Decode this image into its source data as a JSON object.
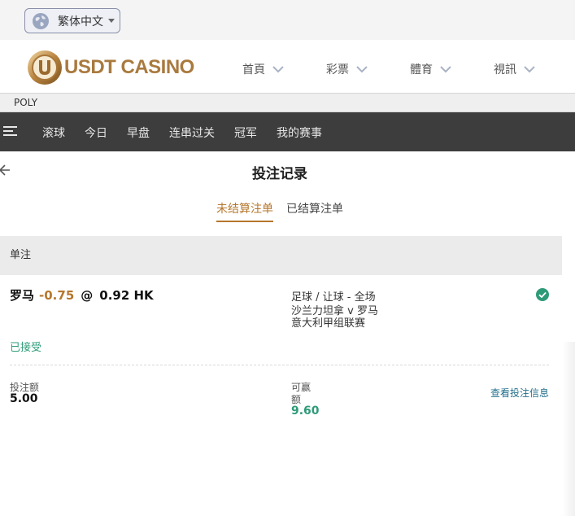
{
  "language": {
    "label": "繁体中文"
  },
  "brand": {
    "name": "USDT CASINO",
    "accent": "#a97a3f"
  },
  "header_nav": [
    "首頁",
    "彩票",
    "體育",
    "視訊"
  ],
  "provider": {
    "label": "POLY"
  },
  "sports_nav": {
    "items": [
      "滚球",
      "今日",
      "早盘",
      "连串过关",
      "冠军",
      "我的赛事"
    ]
  },
  "page": {
    "title": "投注记录"
  },
  "tabs": {
    "active": "未结算注单",
    "inactive": "已结算注单"
  },
  "section": {
    "label": "单注"
  },
  "bet": {
    "selection": "罗马",
    "handicap": "-0.75",
    "at": "@",
    "price": "0.92 HK",
    "market": "足球 / 让球 - 全场",
    "match": "沙兰力坦拿 v 罗马",
    "league": "意大利甲组联赛",
    "status": "已接受",
    "stake_label": "投注额",
    "stake_value": "5.00",
    "win_label_line1": "可赢",
    "win_label_line2": "额",
    "win_value": "9.60",
    "details_link": "查看投注信息"
  },
  "colors": {
    "gold": "#b6772d",
    "green": "#2e9b78",
    "link": "#24708d",
    "dark_nav": "#3d3d3d"
  }
}
